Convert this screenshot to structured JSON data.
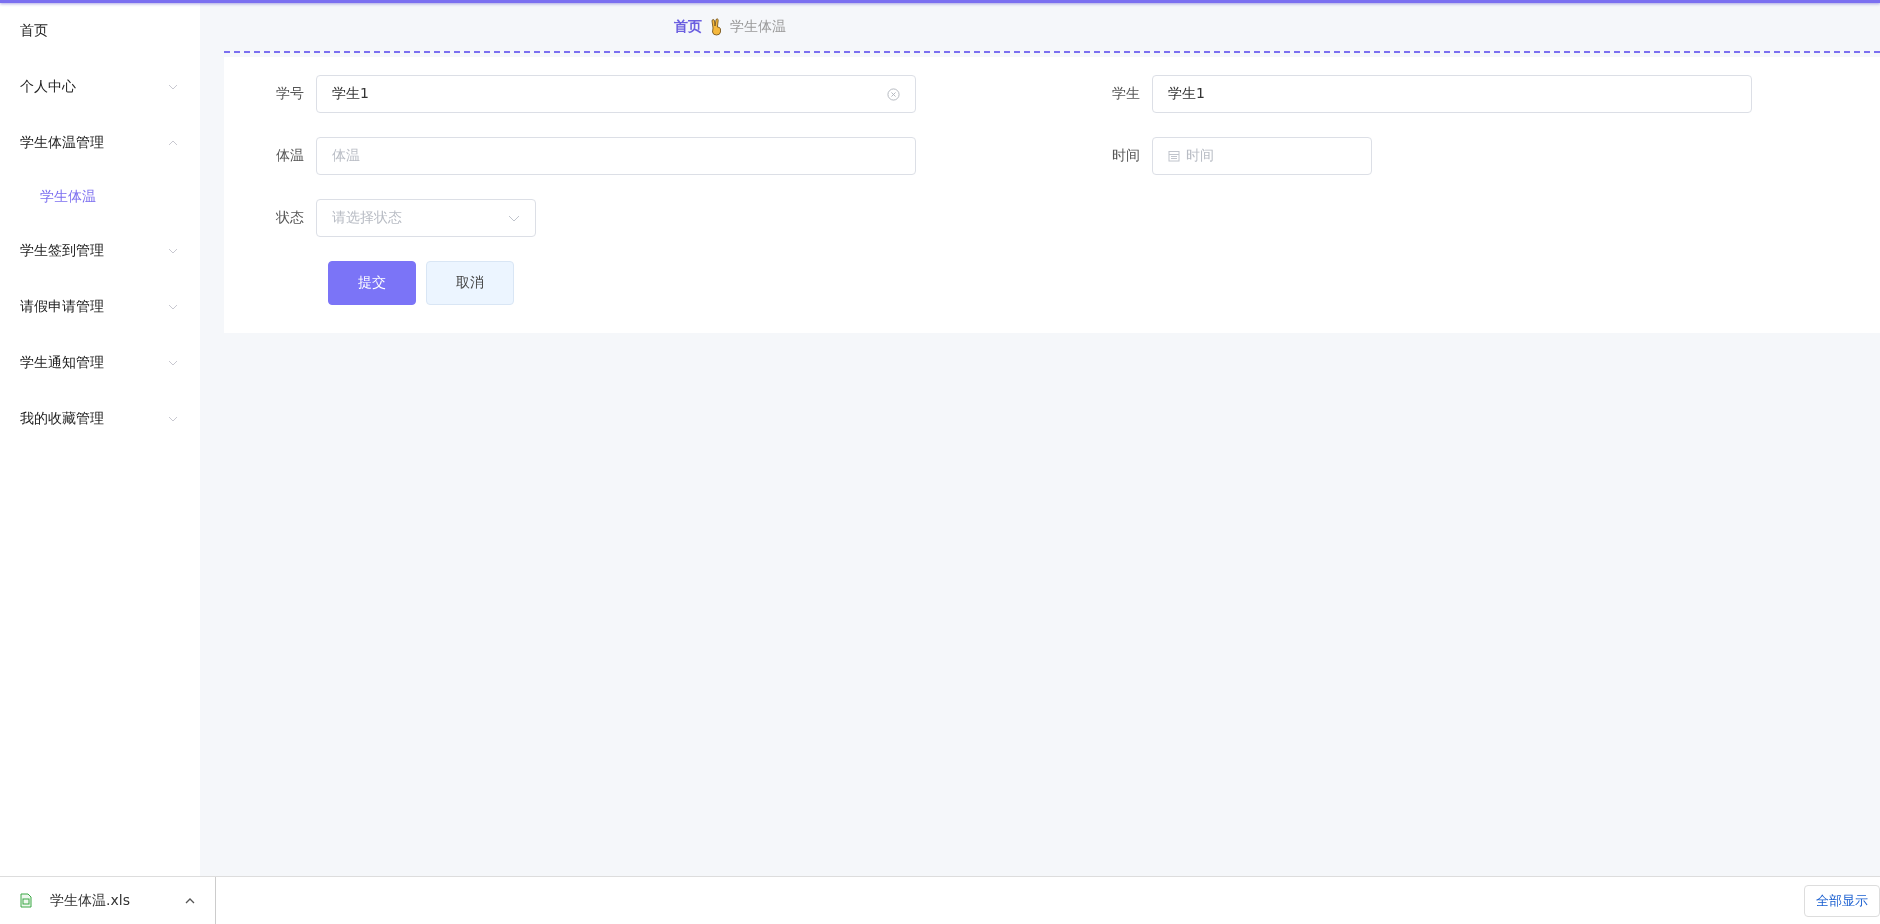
{
  "sidebar": {
    "items": [
      {
        "label": "首页",
        "kind": "link"
      },
      {
        "label": "个人中心",
        "kind": "group",
        "expanded": false
      },
      {
        "label": "学生体温管理",
        "kind": "group",
        "expanded": true,
        "children": [
          {
            "label": "学生体温",
            "selected": true
          }
        ]
      },
      {
        "label": "学生签到管理",
        "kind": "group",
        "expanded": false
      },
      {
        "label": "请假申请管理",
        "kind": "group",
        "expanded": false
      },
      {
        "label": "学生通知管理",
        "kind": "group",
        "expanded": false
      },
      {
        "label": "我的收藏管理",
        "kind": "group",
        "expanded": false
      }
    ]
  },
  "breadcrumb": [
    {
      "label": "首页",
      "current": false
    },
    {
      "label": "学生体温",
      "current": true
    }
  ],
  "form": {
    "rows": [
      [
        {
          "label": "学号",
          "kind": "text",
          "value": "学生1",
          "clearable": true,
          "wide": true
        },
        {
          "label": "学生",
          "kind": "text",
          "value": "学生1",
          "wide": true
        }
      ],
      [
        {
          "label": "体温",
          "kind": "text",
          "placeholder": "体温",
          "wide": true
        },
        {
          "label": "时间",
          "kind": "date",
          "placeholder": "时间",
          "wide": false
        }
      ],
      [
        {
          "label": "状态",
          "kind": "select",
          "placeholder": "请选择状态",
          "wide": false
        }
      ]
    ],
    "buttons": [
      {
        "label": "提交",
        "kind": "primary"
      },
      {
        "label": "取消",
        "kind": "secondary"
      }
    ]
  },
  "download_bar": {
    "file": "学生体温.xls",
    "show_all": "全部显示"
  }
}
